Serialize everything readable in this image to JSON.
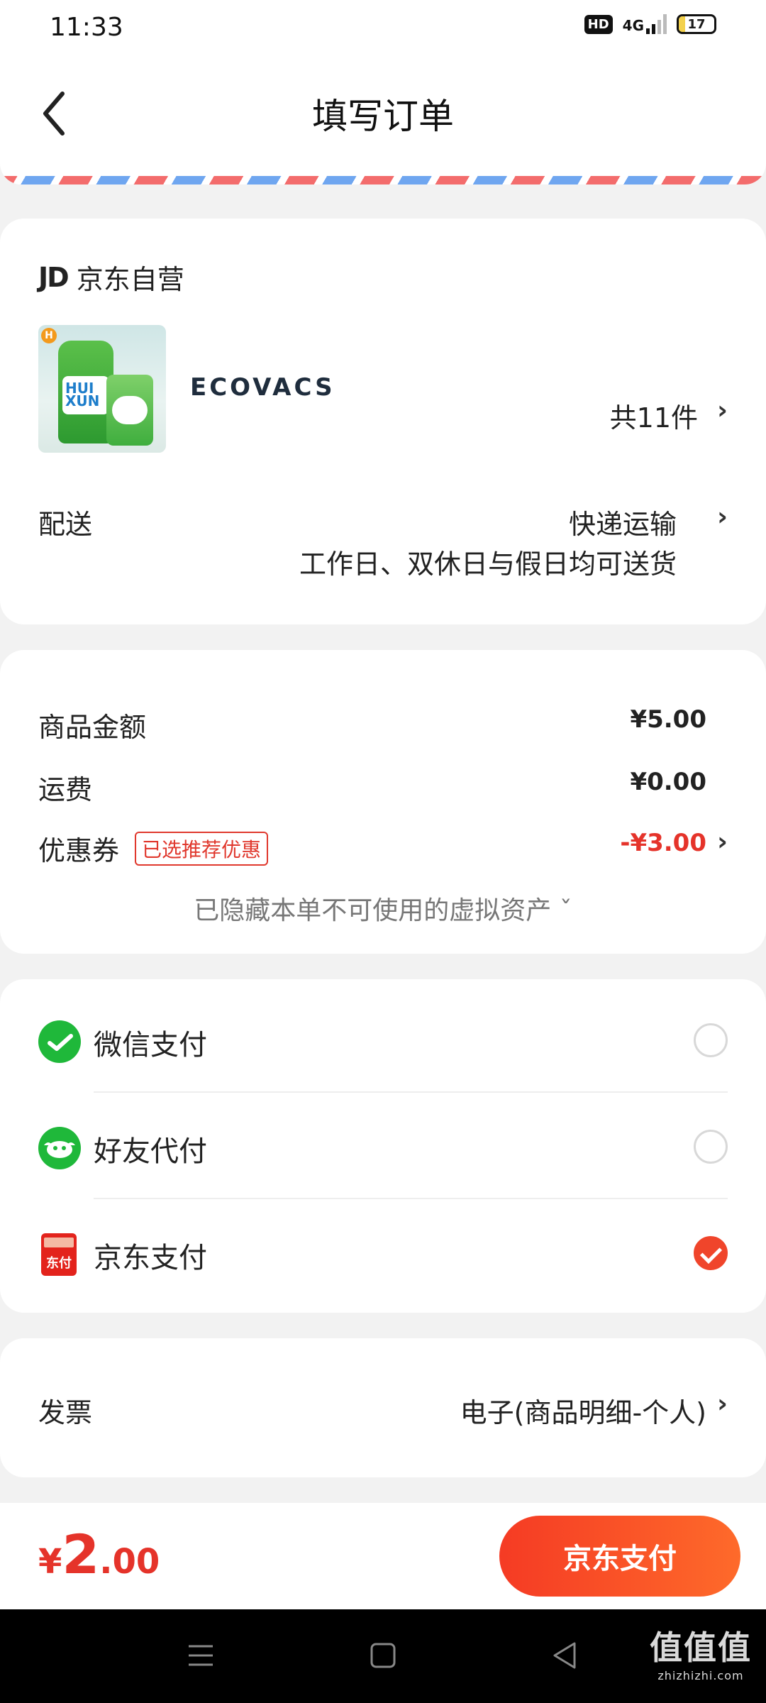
{
  "status_bar": {
    "time": "11:33",
    "hd": "HD",
    "network": "4G",
    "battery": "17",
    "battery_fill": 0.17
  },
  "header": {
    "title": "填写订单"
  },
  "order": {
    "shop_logo": "JD",
    "shop_name": "京东自营",
    "brand_logo": "ECOVACS",
    "product_label": "HUI XUN",
    "item_count": "共11件",
    "delivery_label": "配送",
    "delivery_method": "快递运输",
    "delivery_note": "工作日、双休日与假日均可送货"
  },
  "pricing": {
    "goods_label": "商品金额",
    "goods_value": "¥5.00",
    "shipping_label": "运费",
    "shipping_value": "¥0.00",
    "coupon_label": "优惠券",
    "coupon_tag": "已选推荐优惠",
    "coupon_value": "-¥3.00",
    "hidden_assets_note": "已隐藏本单不可使用的虚拟资产 ˇ"
  },
  "payment": {
    "options": [
      {
        "name": "微信支付",
        "icon": "wechat-pay-icon",
        "selected": false
      },
      {
        "name": "好友代付",
        "icon": "friend-pay-icon",
        "selected": false
      },
      {
        "name": "京东支付",
        "icon": "jd-pay-icon",
        "selected": true
      }
    ],
    "jd_icon_text": "东付"
  },
  "invoice": {
    "label": "发票",
    "value": "电子(商品明细-个人)"
  },
  "footer": {
    "total_currency": "¥",
    "total_integer": "2",
    "total_decimal": ".00",
    "pay_button": "京东支付"
  },
  "watermark": {
    "title": "值值值",
    "domain": "zhizhizhi.com"
  },
  "colors": {
    "accent": "#e5332a",
    "button_start": "#f53b24",
    "button_end": "#fe6a2a",
    "wechat_green": "#1fb83a"
  }
}
